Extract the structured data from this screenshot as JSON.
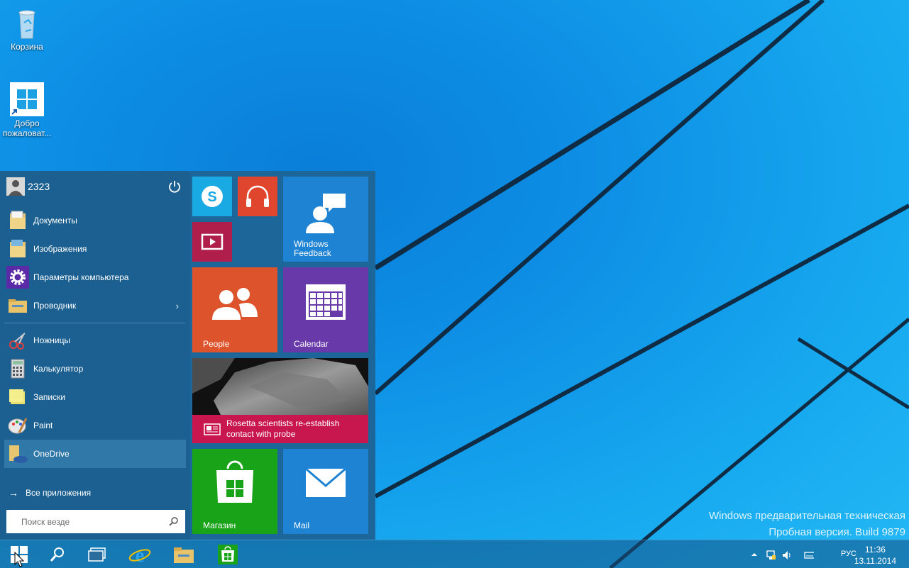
{
  "desktop": {
    "icons": [
      {
        "label": "Корзина",
        "icon": "recycle-bin-icon"
      },
      {
        "label": "Добро пожаловат...",
        "icon": "windows-welcome-icon"
      }
    ],
    "watermark": {
      "line1": "Windows предварительная техническая",
      "line2": "Пробная версия. Build 9879"
    }
  },
  "start_menu": {
    "user": {
      "name": "2323",
      "icon": "user-avatar-icon"
    },
    "power_icon": "power-icon",
    "places": [
      {
        "label": "Документы",
        "icon": "documents-folder-icon"
      },
      {
        "label": "Изображения",
        "icon": "pictures-folder-icon"
      },
      {
        "label": "Параметры компьютера",
        "icon": "gear-icon"
      },
      {
        "label": "Проводник",
        "icon": "file-explorer-icon",
        "has_submenu": true
      }
    ],
    "apps": [
      {
        "label": "Ножницы",
        "icon": "snipping-tool-icon"
      },
      {
        "label": "Калькулятор",
        "icon": "calculator-icon"
      },
      {
        "label": "Записки",
        "icon": "sticky-notes-icon"
      },
      {
        "label": "Paint",
        "icon": "paint-icon"
      },
      {
        "label": "OneDrive",
        "icon": "onedrive-icon",
        "selected": true
      }
    ],
    "all_apps_label": "Все приложения",
    "search_placeholder": "Поиск везде",
    "tiles": {
      "skype": {
        "icon": "skype-icon",
        "color": "#19a9e3"
      },
      "music": {
        "icon": "headphones-icon",
        "color": "#e0462d"
      },
      "video": {
        "icon": "video-icon",
        "color": "#b01e4c"
      },
      "feedback": {
        "label_line1": "Windows",
        "label_line2": "Feedback",
        "icon": "feedback-icon",
        "color": "#1f83d3"
      },
      "people": {
        "label": "People",
        "icon": "people-icon",
        "color": "#dd532b"
      },
      "calendar": {
        "label": "Calendar",
        "icon": "calendar-icon",
        "color": "#6839a8"
      },
      "news": {
        "headline_line1": "Rosetta scientists re-establish",
        "headline_line2": "contact with probe",
        "icon": "news-icon",
        "color": "#c8164e"
      },
      "store": {
        "label": "Магазин",
        "icon": "store-icon",
        "color": "#18a318"
      },
      "mail": {
        "label": "Mail",
        "icon": "mail-icon",
        "color": "#1f83d3"
      }
    }
  },
  "taskbar": {
    "buttons": [
      {
        "icon": "windows-start-icon"
      },
      {
        "icon": "search-icon"
      },
      {
        "icon": "task-view-icon"
      },
      {
        "icon": "internet-explorer-icon"
      },
      {
        "icon": "file-explorer-icon"
      },
      {
        "icon": "store-icon"
      }
    ],
    "tray": {
      "icons": [
        "chevron-up-icon",
        "network-icon",
        "volume-icon",
        "keyboard-icon"
      ],
      "language": "РУС",
      "time": "11:36",
      "date": "13.11.2014"
    }
  },
  "colors": {
    "desktop_blue": "#1aa7ec",
    "start_left": "#1b6090",
    "start_tiles_bg": "#1d6699",
    "taskbar": "#18608f"
  }
}
